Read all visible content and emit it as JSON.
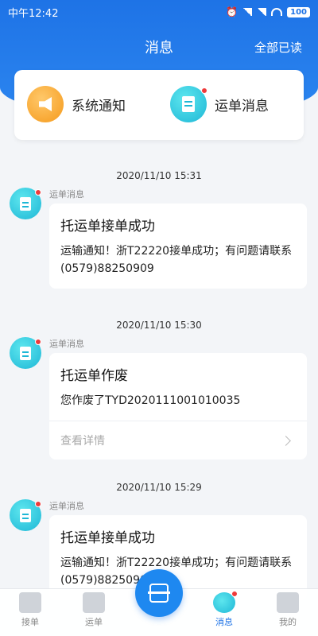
{
  "status_bar": {
    "time": "中午12:42",
    "battery": "100"
  },
  "nav": {
    "title": "消息",
    "mark_all_read": "全部已读"
  },
  "categories": [
    {
      "label": "系统通知",
      "icon": "megaphone-icon",
      "color": "#f59a1c",
      "unread": false
    },
    {
      "label": "运单消息",
      "icon": "document-icon",
      "color": "#1eb7d6",
      "unread": true
    }
  ],
  "messages": [
    {
      "time": "2020/11/10 15:31",
      "source": "运单消息",
      "title": "托运单接单成功",
      "body": "运输通知！浙T22220接单成功；有问题请联系(0579)88250909"
    },
    {
      "time": "2020/11/10 15:30",
      "source": "运单消息",
      "title": "托运单作废",
      "body": "您作废了TYD2020111001010035",
      "detail": "查看详情"
    },
    {
      "time": "2020/11/10 15:29",
      "source": "运单消息",
      "title": "托运单接单成功",
      "body": "运输通知！浙T22220接单成功；有问题请联系(0579)88250909"
    }
  ],
  "tabbar": {
    "tabs": [
      {
        "label": "接单",
        "icon": "package-icon"
      },
      {
        "label": "运单",
        "icon": "truck-icon"
      },
      {
        "label": "消息",
        "icon": "message-icon"
      },
      {
        "label": "我的",
        "icon": "profile-icon"
      }
    ],
    "scan_icon": "scan-icon",
    "active_color": "#1e73e6"
  },
  "colors": {
    "primary": "#1e73e6",
    "unread_dot": "#ee3a3a"
  }
}
